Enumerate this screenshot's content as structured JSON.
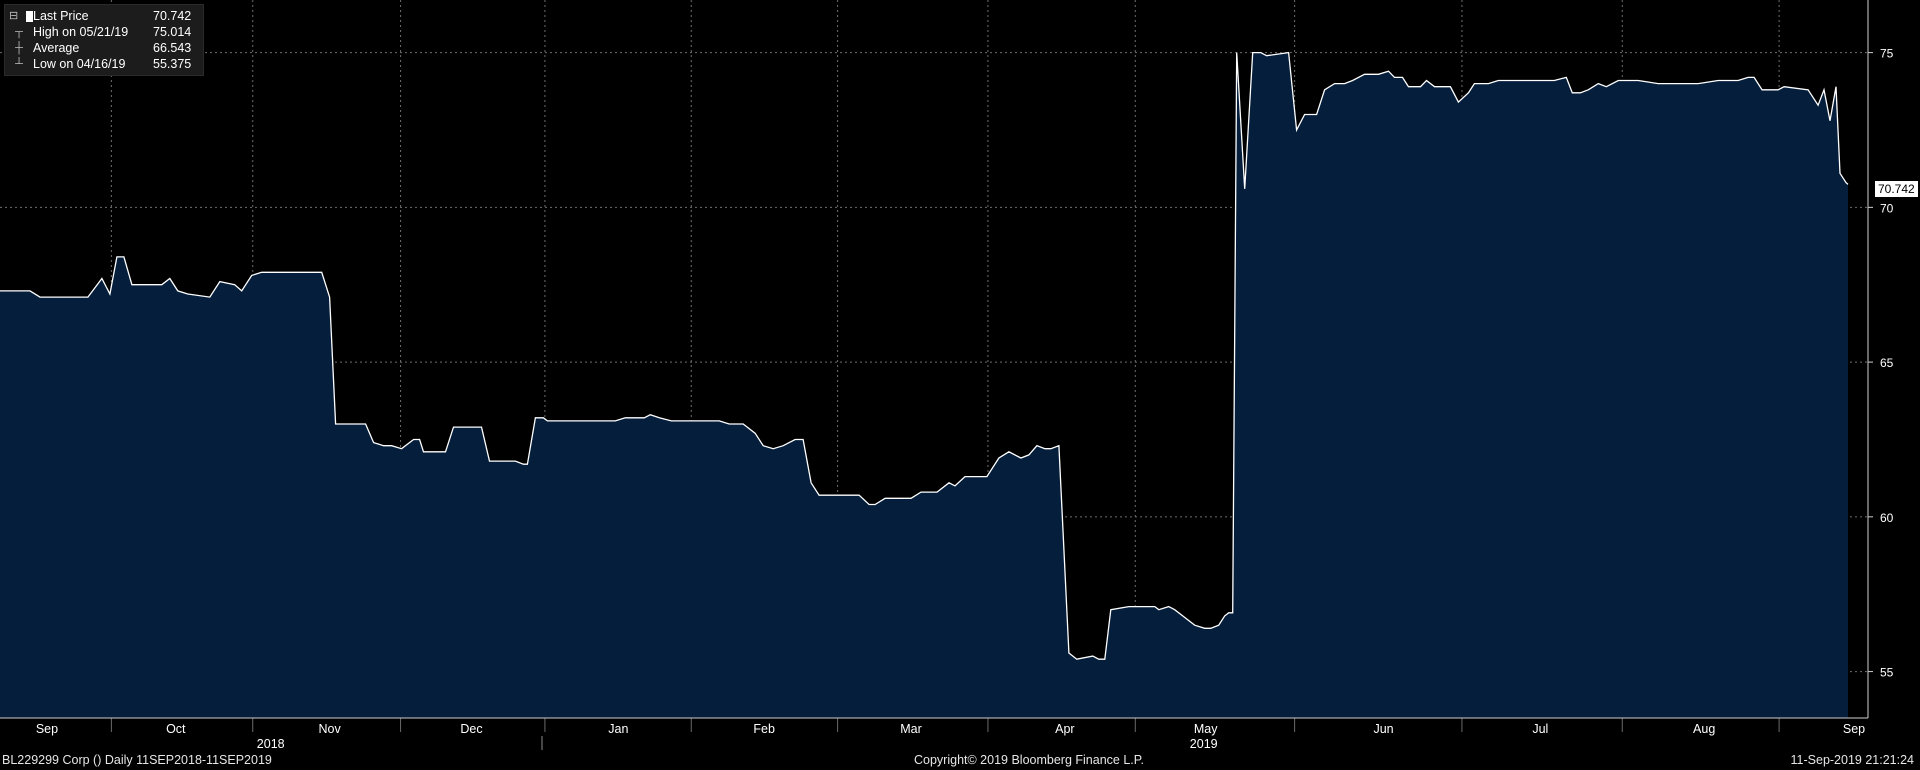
{
  "legend": {
    "items": [
      {
        "label": "Last Price",
        "value": "70.742",
        "marker": "swatch"
      },
      {
        "label": "High on 05/21/19",
        "value": "75.014",
        "marker": "high-marker"
      },
      {
        "label": "Average",
        "value": "66.543",
        "marker": "average-marker"
      },
      {
        "label": "Low on 04/16/19",
        "value": "55.375",
        "marker": "low-marker"
      }
    ]
  },
  "last_tag": "70.742",
  "footer": {
    "left": "BL229299 Corp ()  Daily 11SEP2018-11SEP2019",
    "center": "Copyright© 2019 Bloomberg Finance L.P.",
    "right": "11-Sep-2019 21:21:24"
  },
  "colors": {
    "background": "#000000",
    "area_fill": "#041e3b",
    "line": "#ffffff",
    "grid": "#6e6e6e",
    "text": "#ffffff"
  },
  "chart_data": {
    "type": "area",
    "title": "",
    "xlabel": "",
    "ylabel": "",
    "ylim": [
      53.5,
      76.7
    ],
    "y_ticks": [
      55,
      60,
      65,
      70,
      75
    ],
    "x_range": [
      0,
      1870
    ],
    "month_labels": [
      {
        "label": "Sep",
        "x": 47
      },
      {
        "label": "Oct",
        "x": 176
      },
      {
        "label": "Nov",
        "x": 330
      },
      {
        "label": "Dec",
        "x": 472
      },
      {
        "label": "Jan",
        "x": 619
      },
      {
        "label": "Feb",
        "x": 765
      },
      {
        "label": "Mar",
        "x": 912
      },
      {
        "label": "Apr",
        "x": 1066
      },
      {
        "label": "May",
        "x": 1207
      },
      {
        "label": "Jun",
        "x": 1385
      },
      {
        "label": "Jul",
        "x": 1542
      },
      {
        "label": "Aug",
        "x": 1706
      },
      {
        "label": "Sep",
        "x": 1856
      }
    ],
    "year_labels": [
      {
        "label": "2018",
        "x": 271
      },
      {
        "label": "2019",
        "x": 1205
      }
    ],
    "series": [
      {
        "points": [
          [
            0,
            67.3
          ],
          [
            30,
            67.3
          ],
          [
            40,
            67.1
          ],
          [
            88,
            67.1
          ],
          [
            102,
            67.7
          ],
          [
            110,
            67.2
          ],
          [
            117,
            68.4
          ],
          [
            124,
            68.4
          ],
          [
            132,
            67.5
          ],
          [
            162,
            67.5
          ],
          [
            170,
            67.7
          ],
          [
            178,
            67.3
          ],
          [
            188,
            67.2
          ],
          [
            210,
            67.1
          ],
          [
            220,
            67.6
          ],
          [
            235,
            67.5
          ],
          [
            242,
            67.3
          ],
          [
            252,
            67.8
          ],
          [
            262,
            67.9
          ],
          [
            322,
            67.9
          ],
          [
            330,
            67.1
          ],
          [
            336,
            63.0
          ],
          [
            366,
            63.0
          ],
          [
            374,
            62.4
          ],
          [
            384,
            62.3
          ],
          [
            392,
            62.3
          ],
          [
            402,
            62.2
          ],
          [
            414,
            62.5
          ],
          [
            420,
            62.5
          ],
          [
            424,
            62.1
          ],
          [
            446,
            62.1
          ],
          [
            454,
            62.9
          ],
          [
            482,
            62.9
          ],
          [
            490,
            61.8
          ],
          [
            516,
            61.8
          ],
          [
            524,
            61.7
          ],
          [
            528,
            61.7
          ],
          [
            536,
            63.2
          ],
          [
            544,
            63.2
          ],
          [
            548,
            63.1
          ],
          [
            616,
            63.1
          ],
          [
            626,
            63.2
          ],
          [
            645,
            63.2
          ],
          [
            651,
            63.3
          ],
          [
            660,
            63.2
          ],
          [
            672,
            63.1
          ],
          [
            720,
            63.1
          ],
          [
            730,
            63.0
          ],
          [
            744,
            63.0
          ],
          [
            756,
            62.7
          ],
          [
            764,
            62.3
          ],
          [
            774,
            62.2
          ],
          [
            784,
            62.3
          ],
          [
            796,
            62.5
          ],
          [
            804,
            62.5
          ],
          [
            812,
            61.1
          ],
          [
            820,
            60.7
          ],
          [
            860,
            60.7
          ],
          [
            870,
            60.4
          ],
          [
            876,
            60.4
          ],
          [
            886,
            60.6
          ],
          [
            912,
            60.6
          ],
          [
            922,
            60.8
          ],
          [
            938,
            60.8
          ],
          [
            950,
            61.1
          ],
          [
            956,
            61.0
          ],
          [
            966,
            61.3
          ],
          [
            988,
            61.3
          ],
          [
            1000,
            61.9
          ],
          [
            1010,
            62.1
          ],
          [
            1022,
            61.9
          ],
          [
            1030,
            62.0
          ],
          [
            1038,
            62.3
          ],
          [
            1046,
            62.2
          ],
          [
            1052,
            62.2
          ],
          [
            1060,
            62.3
          ],
          [
            1070,
            55.6
          ],
          [
            1078,
            55.4
          ],
          [
            1094,
            55.5
          ],
          [
            1100,
            55.4
          ],
          [
            1106,
            55.4
          ],
          [
            1112,
            57.0
          ],
          [
            1130,
            57.1
          ],
          [
            1156,
            57.1
          ],
          [
            1160,
            57.0
          ],
          [
            1170,
            57.1
          ],
          [
            1176,
            57.0
          ],
          [
            1184,
            56.8
          ],
          [
            1196,
            56.5
          ],
          [
            1206,
            56.4
          ],
          [
            1212,
            56.4
          ],
          [
            1220,
            56.5
          ],
          [
            1226,
            56.8
          ],
          [
            1230,
            56.9
          ],
          [
            1234,
            56.9
          ],
          [
            1238,
            75.0
          ],
          [
            1246,
            70.6
          ],
          [
            1254,
            75.0
          ],
          [
            1262,
            75.0
          ],
          [
            1268,
            74.9
          ],
          [
            1290,
            75.0
          ],
          [
            1298,
            72.5
          ],
          [
            1306,
            73.0
          ],
          [
            1318,
            73.0
          ],
          [
            1326,
            73.8
          ],
          [
            1336,
            74.0
          ],
          [
            1346,
            74.0
          ],
          [
            1354,
            74.1
          ],
          [
            1366,
            74.3
          ],
          [
            1380,
            74.3
          ],
          [
            1390,
            74.4
          ],
          [
            1396,
            74.2
          ],
          [
            1404,
            74.2
          ],
          [
            1410,
            73.9
          ],
          [
            1422,
            73.9
          ],
          [
            1428,
            74.1
          ],
          [
            1436,
            73.9
          ],
          [
            1452,
            73.9
          ],
          [
            1460,
            73.4
          ],
          [
            1470,
            73.7
          ],
          [
            1476,
            74.0
          ],
          [
            1490,
            74.0
          ],
          [
            1500,
            74.1
          ],
          [
            1556,
            74.1
          ],
          [
            1568,
            74.2
          ],
          [
            1574,
            73.7
          ],
          [
            1582,
            73.7
          ],
          [
            1590,
            73.8
          ],
          [
            1600,
            74.0
          ],
          [
            1608,
            73.9
          ],
          [
            1620,
            74.1
          ],
          [
            1640,
            74.1
          ],
          [
            1660,
            74.0
          ],
          [
            1700,
            74.0
          ],
          [
            1720,
            74.1
          ],
          [
            1740,
            74.1
          ],
          [
            1750,
            74.2
          ],
          [
            1756,
            74.2
          ],
          [
            1764,
            73.8
          ],
          [
            1780,
            73.8
          ],
          [
            1786,
            73.9
          ],
          [
            1810,
            73.8
          ],
          [
            1820,
            73.3
          ],
          [
            1826,
            73.8
          ],
          [
            1832,
            72.8
          ],
          [
            1838,
            73.9
          ],
          [
            1842,
            71.1
          ],
          [
            1848,
            70.8
          ],
          [
            1850,
            70.742
          ]
        ]
      }
    ]
  }
}
